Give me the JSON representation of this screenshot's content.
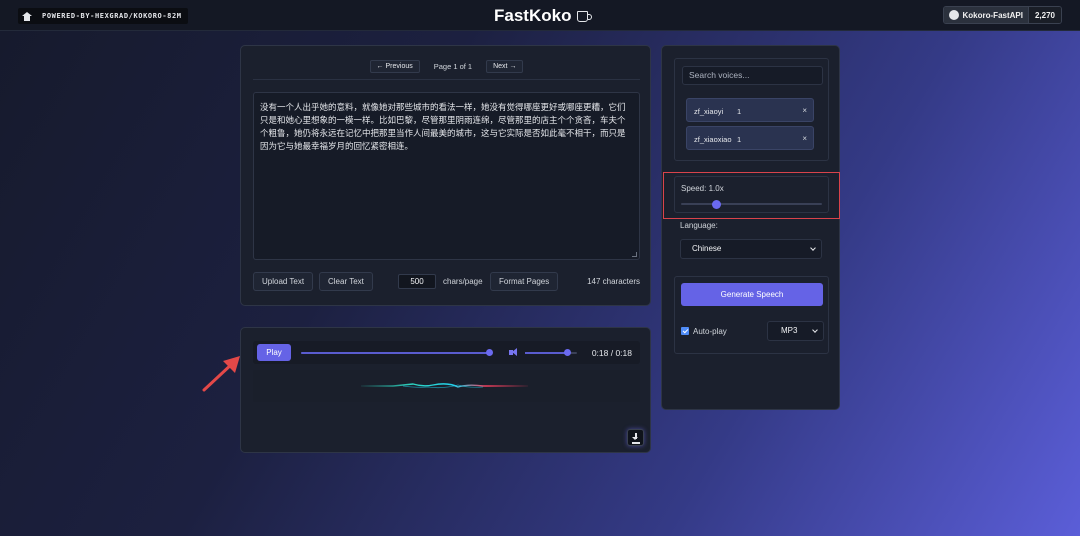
{
  "header": {
    "badge_text": "POWERED-BY-HEXGRAD/KOKORO-82M",
    "title": "FastKoko",
    "github_label": "Kokoro-FastAPI",
    "github_count": "2,270"
  },
  "editor": {
    "prev_label": "← Previous",
    "page_indicator": "Page 1 of 1",
    "next_label": "Next →",
    "text": "没有一个人出乎她的意料，就像她对那些城市的看法一样，她没有觉得哪座更好或哪座更糟，它们只是和她心里想象的一模一样。比如巴黎，尽管那里阴雨连绵，尽管那里的店主个个贪吝，车夫个个粗鲁，她仍将永远在记忆中把那里当作人间最美的城市，这与它实际是否如此毫不相干，而只是因为它与她最幸福岁月的回忆紧密相连。",
    "upload_label": "Upload Text",
    "clear_label": "Clear Text",
    "chars_per_page_value": "500",
    "chars_per_page_label": "chars/page",
    "format_label": "Format Pages",
    "char_count": "147 characters"
  },
  "player": {
    "play_label": "Play",
    "time": "0:18 / 0:18",
    "progress": 1.0,
    "volume": 0.8
  },
  "voices": {
    "search_placeholder": "Search voices...",
    "selected": [
      {
        "name": "zf_xiaoyi",
        "weight": "1",
        "remove": "×"
      },
      {
        "name": "zf_xiaoxiao",
        "weight": "1",
        "remove": "×"
      }
    ]
  },
  "settings": {
    "speed_label": "Speed: 1.0x",
    "speed_fraction": 0.25,
    "language_label": "Language:",
    "language_value": "Chinese",
    "generate_label": "Generate Speech",
    "autoplay_label": "Auto-play",
    "format_value": "MP3"
  },
  "colors": {
    "accent": "#6563e6",
    "highlight_box": "#d9434b",
    "arrow": "#e34848"
  }
}
